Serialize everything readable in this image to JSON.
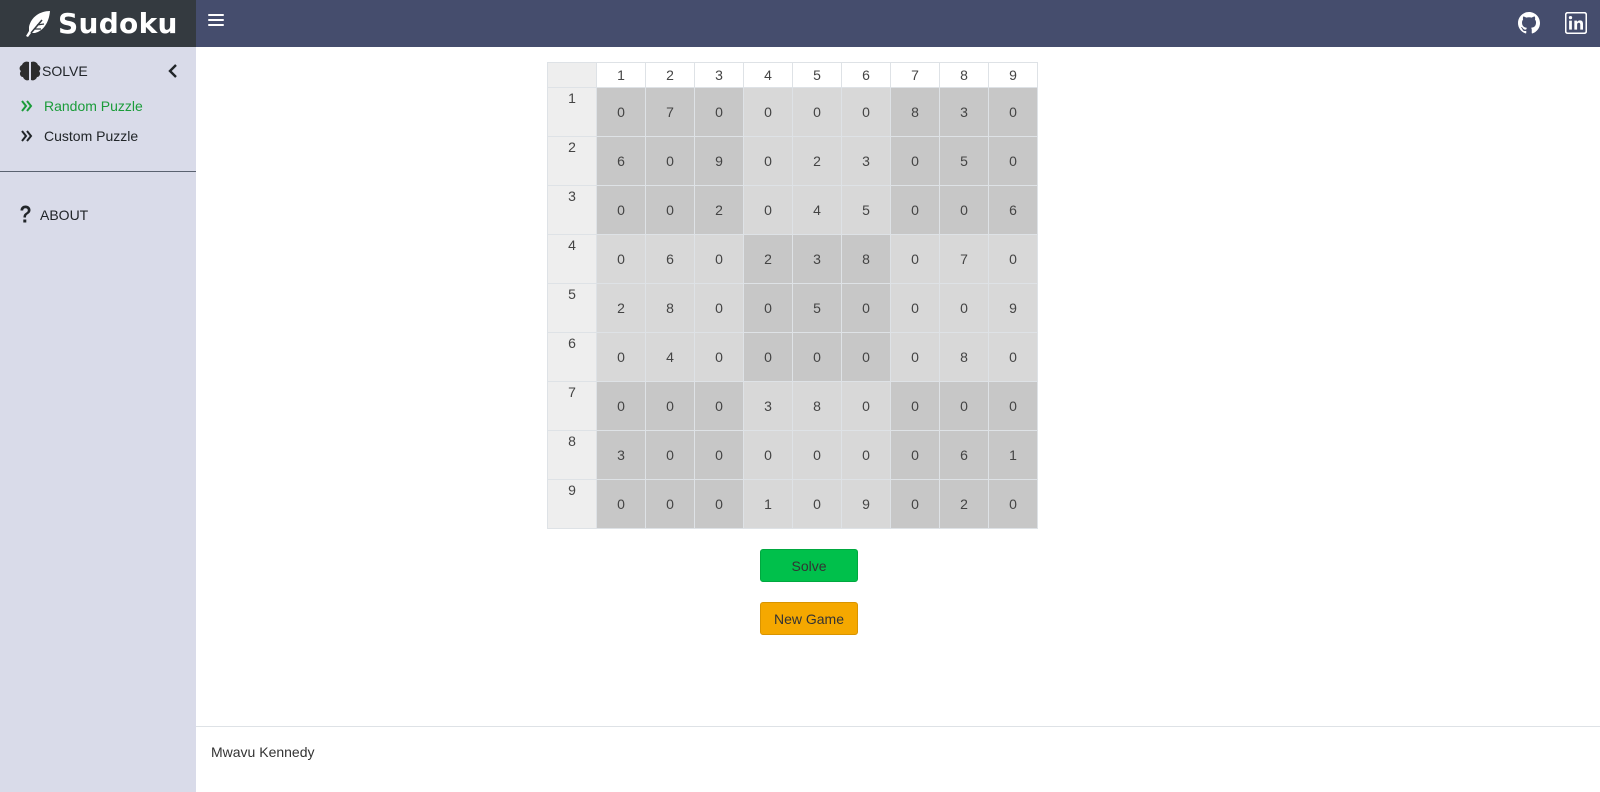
{
  "brand": {
    "title": "Sudoku",
    "icon": "feather-icon"
  },
  "topbar": {
    "menu_icon": "bars-icon",
    "github_icon": "github-icon",
    "linkedin_icon": "linkedin-icon"
  },
  "sidebar": {
    "section_label": "SOLVE",
    "items": [
      {
        "label": "Random Puzzle",
        "icon": "double-chevron-right-icon",
        "active": true
      },
      {
        "label": "Custom Puzzle",
        "icon": "double-chevron-right-icon",
        "active": false
      }
    ],
    "about_label": "ABOUT"
  },
  "board": {
    "col_headers": [
      "1",
      "2",
      "3",
      "4",
      "5",
      "6",
      "7",
      "8",
      "9"
    ],
    "row_headers": [
      "1",
      "2",
      "3",
      "4",
      "5",
      "6",
      "7",
      "8",
      "9"
    ],
    "rows": [
      [
        0,
        7,
        0,
        0,
        0,
        0,
        8,
        3,
        0
      ],
      [
        6,
        0,
        9,
        0,
        2,
        3,
        0,
        5,
        0
      ],
      [
        0,
        0,
        2,
        0,
        4,
        5,
        0,
        0,
        6
      ],
      [
        0,
        6,
        0,
        2,
        3,
        8,
        0,
        7,
        0
      ],
      [
        2,
        8,
        0,
        0,
        5,
        0,
        0,
        0,
        9
      ],
      [
        0,
        4,
        0,
        0,
        0,
        0,
        0,
        8,
        0
      ],
      [
        0,
        0,
        0,
        3,
        8,
        0,
        0,
        0,
        0
      ],
      [
        3,
        0,
        0,
        0,
        0,
        0,
        0,
        6,
        1
      ],
      [
        0,
        0,
        0,
        1,
        0,
        9,
        0,
        2,
        0
      ]
    ]
  },
  "buttons": {
    "solve": "Solve",
    "new_game": "New Game"
  },
  "footer": {
    "author": "Mwavu Kennedy"
  },
  "colors": {
    "solve": "#00c04b",
    "new_game": "#f5a800",
    "active_link": "#1b9c3a",
    "topbar": "#454d6d",
    "brand_bg": "#343a40",
    "sidebar": "#d9dbe9"
  }
}
